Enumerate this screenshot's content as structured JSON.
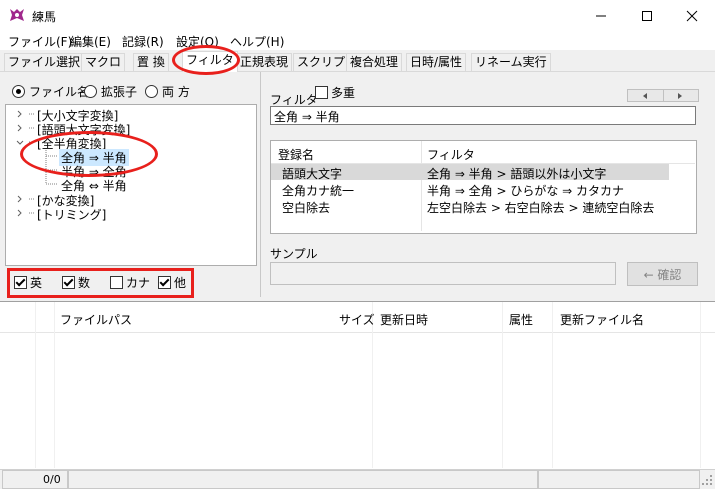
{
  "window": {
    "title": "練馬"
  },
  "colors": {
    "highlight": "#cce8ff",
    "annotation": "#e8201c",
    "selected_row": "#d9d9d9"
  },
  "menu": [
    "ファイル(F)",
    "編集(E)",
    "記録(R)",
    "設定(O)",
    "ヘルプ(H)"
  ],
  "tabs": [
    "ファイル選択",
    "マクロ",
    "置 換",
    "フィルタ",
    "正規表現",
    "スクリプト",
    "複合処理",
    "日時/属性",
    "リネーム実行"
  ],
  "left": {
    "radio_filename": "ファイル名",
    "radio_ext": "拡張子",
    "radio_both": "両 方",
    "tree": {
      "n1": "[大小文字変換]",
      "n2": "[語頭大文字変換]",
      "n3": "[全半角変換]",
      "n3a": "全角 ⇒ 半角",
      "n3b": "半角 ⇒ 全角",
      "n3c": "全角 ⇔ 半角",
      "n4": "[かな変換]",
      "n5": "[トリミング]"
    },
    "checks": {
      "c1": "英",
      "c2": "数",
      "c3": "カナ",
      "c4": "他"
    }
  },
  "right": {
    "filter_label": "フィルタ",
    "multi_label": "多重",
    "filter_value": "全角 ⇒ 半角",
    "col_name": "登録名",
    "col_filter": "フィルタ",
    "rows": [
      {
        "name": "語頭大文字",
        "filter": "全角 ⇒ 半角 > 語頭以外は小文字"
      },
      {
        "name": "全角カナ統一",
        "filter": "半角 ⇒ 全角 > ひらがな ⇒ カタカナ"
      },
      {
        "name": "空白除去",
        "filter": "左空白除去 > 右空白除去 > 連続空白除去"
      }
    ],
    "sample_label": "サンプル",
    "confirm_btn": "← 確認"
  },
  "file_list": {
    "col_path": "ファイルパス",
    "col_size": "サイズ",
    "col_date": "更新日時",
    "col_attr": "属性",
    "col_newname": "更新ファイル名"
  },
  "status": {
    "count": "0/0"
  }
}
